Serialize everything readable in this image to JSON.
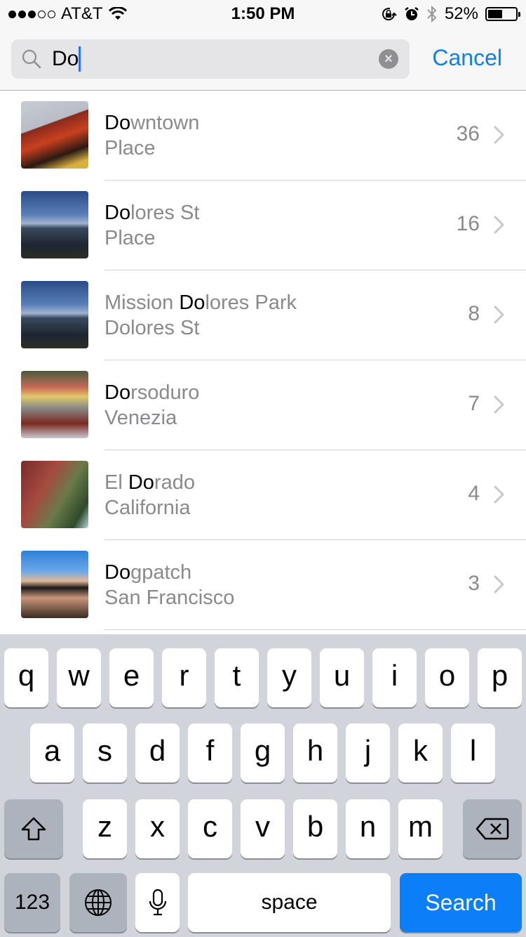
{
  "status_bar": {
    "signal_filled": 3,
    "signal_empty": 2,
    "carrier": "AT&T",
    "time": "1:50 PM",
    "battery_percent_label": "52%",
    "battery_level": 0.52,
    "icons": [
      "wifi-icon",
      "rotation-lock-icon",
      "alarm-icon",
      "bluetooth-icon",
      "battery-icon"
    ]
  },
  "search": {
    "query": "Do",
    "cancel_label": "Cancel"
  },
  "results": [
    {
      "title_pre": "",
      "title_hl": "Do",
      "title_post": "wntown",
      "subtitle": "Place",
      "count": "36",
      "thumb": "theater-marquee"
    },
    {
      "title_pre": "",
      "title_hl": "Do",
      "title_post": "lores St",
      "subtitle": "Place",
      "count": "16",
      "thumb": "city-skyline-dusk"
    },
    {
      "title_pre": "Mission ",
      "title_hl": "Do",
      "title_post": "lores Park",
      "subtitle": "Dolores St",
      "count": "8",
      "thumb": "city-skyline-dusk"
    },
    {
      "title_pre": "",
      "title_hl": "Do",
      "title_post": "rsoduro",
      "subtitle": "Venezia",
      "count": "7",
      "thumb": "venice-square"
    },
    {
      "title_pre": "El ",
      "title_hl": "Do",
      "title_post": "rado",
      "subtitle": "California",
      "count": "4",
      "thumb": "autumn-tree"
    },
    {
      "title_pre": "",
      "title_hl": "Do",
      "title_post": "gpatch",
      "subtitle": "San Francisco",
      "count": "3",
      "thumb": "selfie"
    }
  ],
  "keyboard": {
    "row1": [
      "q",
      "w",
      "e",
      "r",
      "t",
      "y",
      "u",
      "i",
      "o",
      "p"
    ],
    "row2": [
      "a",
      "s",
      "d",
      "f",
      "g",
      "h",
      "j",
      "k",
      "l"
    ],
    "row3": [
      "z",
      "x",
      "c",
      "v",
      "b",
      "n",
      "m"
    ],
    "numbers_label": "123",
    "space_label": "space",
    "action_label": "Search"
  },
  "colors": {
    "accent": "#117ef2",
    "search_key": "#0b7ef8",
    "keyboard_bg": "#d1d4da"
  }
}
